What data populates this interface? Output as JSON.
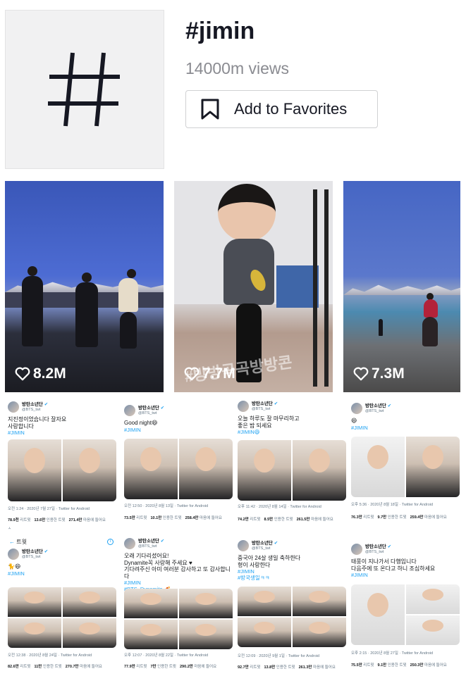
{
  "header": {
    "tag_title": "#jimin",
    "views": "14000m views",
    "favorites_label": "Add to Favorites",
    "hashtag_icon": "hashtag-icon",
    "bookmark_icon": "bookmark-icon"
  },
  "videos": [
    {
      "likes": "8.2M"
    },
    {
      "likes": "7.7M",
      "overlay_text": "#방방곡곡방방콘"
    },
    {
      "likes": "7.3M"
    }
  ],
  "tweets": [
    {
      "name": "방탄소년단",
      "handle": "@BTS_twt",
      "text": "지진정이었습니다 잘자요\n사랑합니다",
      "tag": "#JIMIN",
      "meta": "오전 1:24 · 2020년 7월 27일 · Twitter for Android",
      "stats": {
        "retweets": "78.9천",
        "retweets_label": "리트윗",
        "quotes": "13.6만",
        "quotes_label": "인용한 트윗",
        "likes": "271.4만",
        "likes_label": "마음에 들어요"
      },
      "extra": "ㅅ"
    },
    {
      "name": "방탄소년단",
      "handle": "@BTS_twt",
      "text": "Good night😄",
      "tag": "#JIMIN",
      "meta": "오전 12:50 · 2020년 8월 13일 · Twitter for Android",
      "stats": {
        "retweets": "73.5만",
        "retweets_label": "리트윗",
        "quotes": "10.1만",
        "quotes_label": "인용한 트윗",
        "likes": "258.4만",
        "likes_label": "마음에 들어요"
      }
    },
    {
      "name": "방탄소년단",
      "handle": "@BTS_twt",
      "text": "오늘 하루도 잘 마무리하고\n좋은 밤 되세요",
      "tag": "#JIMIN😄",
      "meta": "오후 11:42 · 2020년 8월 14일 · Twitter for Android",
      "stats": {
        "retweets": "74.2만",
        "retweets_label": "리트윗",
        "quotes": "8.5만",
        "quotes_label": "인용한 트윗",
        "likes": "261.5만",
        "likes_label": "마음에 들어요"
      }
    },
    {
      "name": "방탄소년단",
      "handle": "@BTS_twt",
      "text": "😄",
      "tag": "#JIMIN",
      "meta": "오후 5:36 · 2020년 8월 18일 · Twitter for Android",
      "stats": {
        "retweets": "76.3만",
        "retweets_label": "리트윗",
        "quotes": "9.7만",
        "quotes_label": "인용한 트윗",
        "likes": "259.4만",
        "likes_label": "마음에 들어요"
      }
    },
    {
      "top_bar_title": "트윗",
      "name": "방탄소년단",
      "handle": "@BTS_twt",
      "text": "🐈😄",
      "tag": "#JIMIN",
      "meta": "오전 12:38 · 2020년 8월 24일 · Twitter for Android",
      "stats": {
        "retweets": "82.6만",
        "retweets_label": "리트윗",
        "quotes": "11만",
        "quotes_label": "인용한 트윗",
        "likes": "270.7만",
        "likes_label": "마음에 들어요"
      }
    },
    {
      "name": "방탄소년단",
      "handle": "@BTS_twt",
      "text": "오래 기다리셨어요!\nDynamite꼭 사랑해 주세요 ♥\n기다려주신 아미 여러분 감사하고 또 감사합니다",
      "tag": "#JIMIN\n#BTS_Dynamite 🧨",
      "meta": "오후 12:07 · 2020년 8월 22일 · Twitter for Android",
      "stats": {
        "retweets": "77.9만",
        "retweets_label": "리트윗",
        "quotes": "7만",
        "quotes_label": "인용한 트윗",
        "likes": "290.2만",
        "likes_label": "마음에 들어요"
      }
    },
    {
      "name": "방탄소년단",
      "handle": "@BTS_twt",
      "text": "중국아 24살 생일 축하한다\n형이 사랑한다",
      "tag": "#JIMIN\n#방국생일ㅋㅋ",
      "meta": "오전 12:09 · 2020년 9월 1일 · Twitter for Android",
      "stats": {
        "retweets": "92.7만",
        "retweets_label": "리트윗",
        "quotes": "13.8만",
        "quotes_label": "인용한 트윗",
        "likes": "261.3만",
        "likes_label": "마음에 들어요"
      }
    },
    {
      "name": "방탄소년단",
      "handle": "@BTS_twt",
      "text": "태풍이 지나가서 다행입니다\n다음주에 또 온다고 하니 조심하세요",
      "tag": "#JIMIN",
      "meta": "오후 2:15 · 2020년 8월 27일 · Twitter for Android",
      "stats": {
        "retweets": "75.5만",
        "retweets_label": "리트윗",
        "quotes": "9.1만",
        "quotes_label": "인용한 트윗",
        "likes": "250.3만",
        "likes_label": "마음에 들어요"
      }
    }
  ]
}
